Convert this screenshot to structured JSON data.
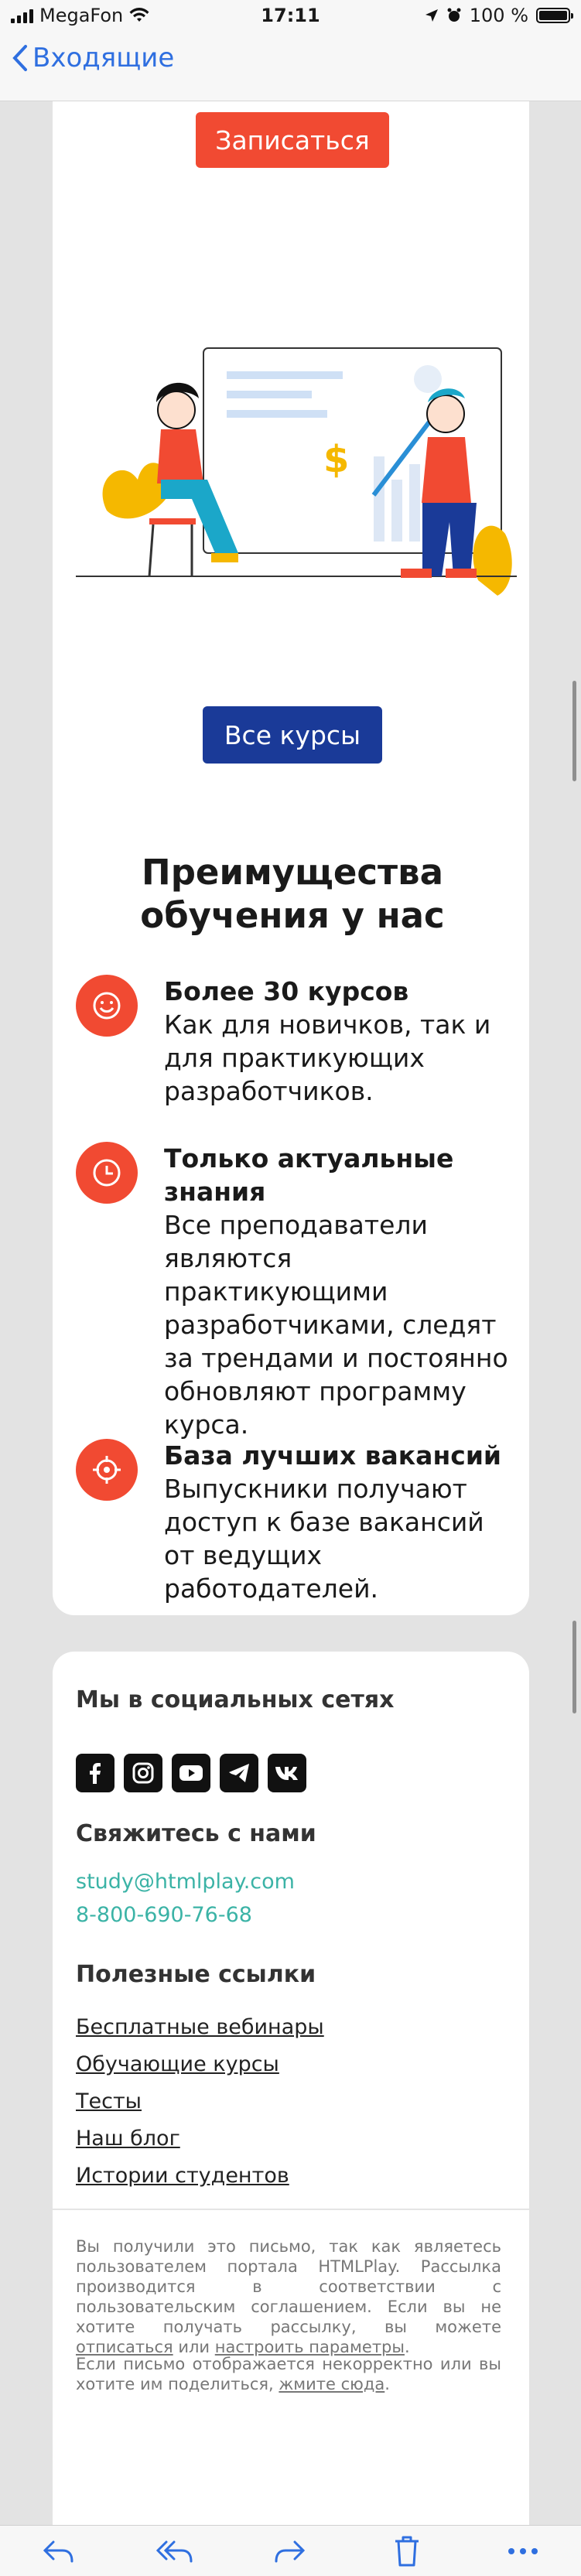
{
  "status_bar": {
    "carrier": "MegaFon",
    "time": "17:11",
    "battery_percent": "100 %"
  },
  "nav": {
    "back_label": "Входящие"
  },
  "hero": {
    "signup_button": "Записаться",
    "courses_button": "Все курсы"
  },
  "advantages": {
    "title": "Преимущества обучения у нас",
    "items": [
      {
        "icon": "smile-icon",
        "title": "Более 30 курсов",
        "text": "Как для новичков, так и для практикующих разработчиков."
      },
      {
        "icon": "clock-icon",
        "title": "Только актуальные знания",
        "text": "Все преподаватели являются практикующими разработчиками, следят за трендами и постоянно обновляют программу курса."
      },
      {
        "icon": "target-icon",
        "title": "База лучших вакансий",
        "text": "Выпускники получают доступ к базе вакансий от ведущих работодателей."
      }
    ]
  },
  "footer": {
    "social_title": "Мы в социальных сетях",
    "social_icons": [
      "facebook-icon",
      "instagram-icon",
      "youtube-icon",
      "telegram-icon",
      "vk-icon"
    ],
    "contact_title": "Свяжитесь с нами",
    "email": "study@htmlplay.com",
    "phone": "8-800-690-76-68",
    "links_title": "Полезные ссылки",
    "links": [
      "Бесплатные вебинары",
      "Обучающие курсы",
      "Тесты",
      "Наш блог",
      "Истории студентов"
    ],
    "legal1_pre": "Вы получили это письмо, так как являетесь пользователем портала HTMLPlay. Рассылка производится в соответствии с пользовательским соглашением. Если вы не хотите получать рассылку, вы можете",
    "legal1_unsub": "отписаться",
    "legal1_or": "или",
    "legal1_settings": "настроить параметры",
    "legal2_pre": "Если письмо отображается некорректно или вы хотите им поделиться,",
    "legal2_link": "жмите сюда"
  },
  "colors": {
    "accent": "#f14a32",
    "primary": "#1a3a98",
    "link_teal": "#3bb3a6",
    "ios_blue": "#2f6fe0"
  }
}
